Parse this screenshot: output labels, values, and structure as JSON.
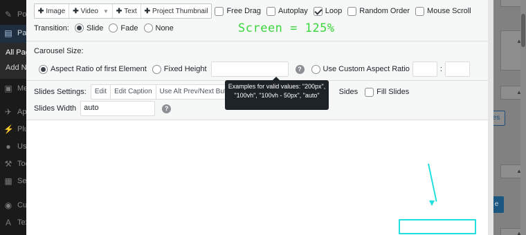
{
  "admin_menu": {
    "items": [
      {
        "icon": "pin-icon",
        "label": "Posts"
      },
      {
        "icon": "pages-icon",
        "label": "Pages"
      },
      {
        "icon": "comments-icon",
        "label": "Media"
      },
      {
        "icon": "appearance-icon",
        "label": "Appearance"
      },
      {
        "icon": "plugins-icon",
        "label": "Plugins"
      },
      {
        "icon": "users-icon",
        "label": "Users"
      },
      {
        "icon": "tools-icon",
        "label": "Tools"
      },
      {
        "icon": "settings-icon",
        "label": "Settings"
      },
      {
        "icon": "eye-icon",
        "label": "Customize"
      },
      {
        "icon": "text-icon",
        "label": "Text"
      }
    ],
    "submenu": [
      "All Pages",
      "Add New"
    ]
  },
  "toolbar": {
    "add_buttons": [
      "Image",
      "Video",
      "Text",
      "Project Thumbnail"
    ],
    "options": [
      {
        "label": "Free Drag",
        "checked": false
      },
      {
        "label": "Autoplay",
        "checked": false
      },
      {
        "label": "Loop",
        "checked": true
      },
      {
        "label": "Random Order",
        "checked": false
      },
      {
        "label": "Mouse Scroll",
        "checked": false
      }
    ]
  },
  "transition": {
    "label": "Transition:",
    "options": [
      {
        "label": "Slide",
        "selected": true
      },
      {
        "label": "Fade",
        "selected": false
      },
      {
        "label": "None",
        "selected": false
      }
    ]
  },
  "screen_note": "Screen = 125%",
  "carousel_size": {
    "label": "Carousel Size:",
    "aspect_first": "Aspect Ratio of first Element",
    "fixed_height": "Fixed Height",
    "custom_aspect": "Use Custom Aspect Ratio",
    "ratio_separator": ":"
  },
  "tooltip": {
    "text": "Examples for valid values: \"200px\", \"100vh\", \"100vh - 50px\", \"auto\""
  },
  "slides_settings": {
    "label": "Slides Settings:",
    "tabs": [
      "Edit",
      "Edit Caption",
      "Use Alt Prev/Next Buttons"
    ],
    "hidden_tail": "Sides",
    "fill_slides": {
      "label": "Fill Slides",
      "checked": false
    }
  },
  "slides_width": {
    "label": "Slides Width",
    "value": "auto"
  },
  "right_column": {
    "btn1": "es",
    "btn2": "e"
  },
  "colors": {
    "annotation": "#23e0e0",
    "note": "#3bd63b",
    "primary": "#1a5680"
  }
}
